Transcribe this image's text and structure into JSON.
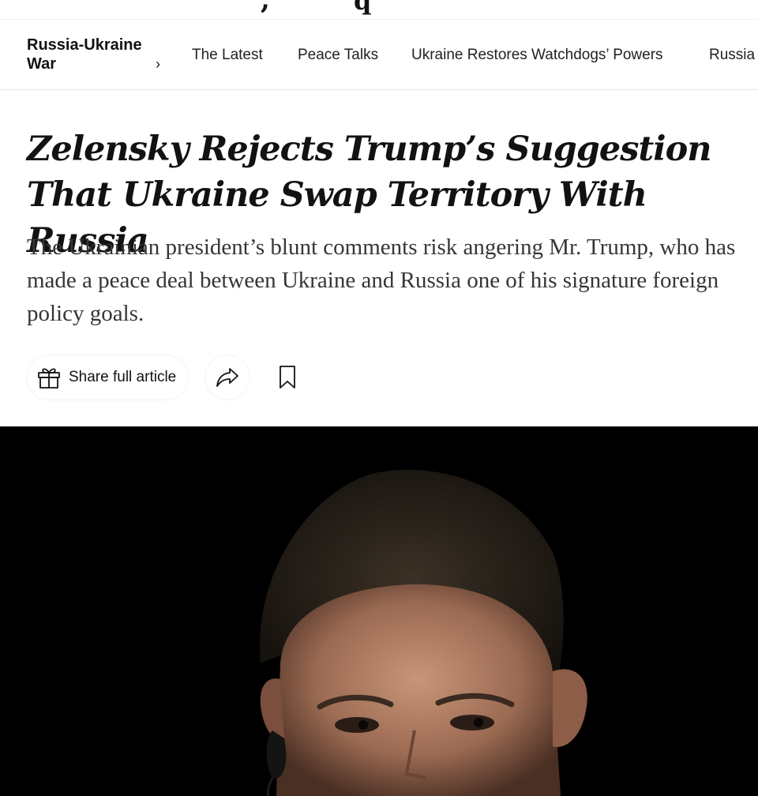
{
  "section": {
    "label": "Russia-Ukraine War",
    "chevron": "›"
  },
  "nav": {
    "items": [
      {
        "label": "The Latest"
      },
      {
        "label": "Peace Talks"
      },
      {
        "label": "Ukraine Restores Watchdogs’ Powers"
      },
      {
        "label": "Russia"
      }
    ]
  },
  "article": {
    "headline": "Zelensky Rejects Trump’s Suggestion That Ukraine Swap Territory With Russia",
    "summary": "The Ukrainian president’s blunt comments risk angering Mr. Trump, who has made a peace deal between Ukraine and Russia one of his signature foreign policy goals."
  },
  "actions": {
    "share_label": "Share full article",
    "share_icon": "gift-icon",
    "forward_icon": "share-arrow-icon",
    "save_icon": "bookmark-icon"
  },
  "photo": {
    "subject": "portrait-photo",
    "background": "#000000"
  }
}
